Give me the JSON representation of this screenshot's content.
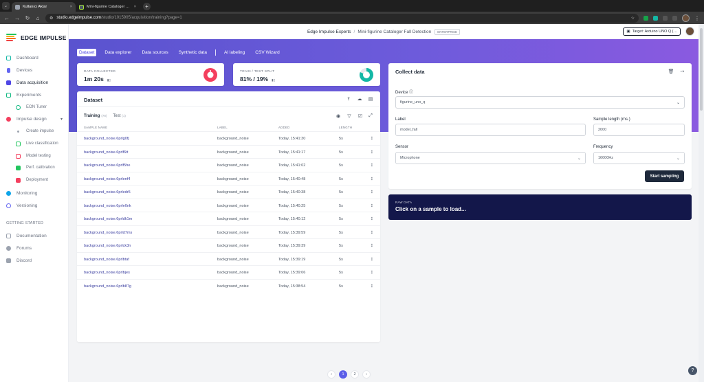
{
  "browser": {
    "tabs": [
      {
        "title": "Kullanıcı Aktar",
        "active": true
      },
      {
        "title": "Mini-figurine Cataloger Fall De",
        "active": false
      }
    ],
    "url_host": "studio.edgeimpulse.com",
    "url_path": "/studio/1015905/acquisition/training?page=1"
  },
  "app": {
    "brand": "EDGE IMPULSE",
    "breadcrumb_owner": "Edge Impulse Experts",
    "breadcrumb_sep": "/",
    "project_name": "Mini-figurine Cataloger Fall Detection",
    "project_badge": "ENTERPRISE",
    "target_label": "Target: Arduino UNO Q (…",
    "accent": "#5b5ee8"
  },
  "sidebar": {
    "items": [
      {
        "label": "Dashboard",
        "icon": "monitor-icon"
      },
      {
        "label": "Devices",
        "icon": "device-icon"
      },
      {
        "label": "Data acquisition",
        "icon": "database-icon",
        "active": true
      },
      {
        "label": "Experiments",
        "icon": "experiments-icon"
      },
      {
        "label": "EON Tuner",
        "icon": "tuner-icon"
      },
      {
        "label": "Impulse design",
        "icon": "impulse-icon"
      },
      {
        "label": "Create impulse",
        "icon": "dot-icon"
      },
      {
        "label": "Live classification",
        "icon": "live-icon"
      },
      {
        "label": "Model testing",
        "icon": "testing-icon"
      },
      {
        "label": "Perf. calibration",
        "icon": "calibration-icon"
      },
      {
        "label": "Deployment",
        "icon": "deploy-icon"
      },
      {
        "label": "Monitoring",
        "icon": "monitoring-icon"
      },
      {
        "label": "Versioning",
        "icon": "versioning-icon"
      }
    ],
    "getting_started_heading": "GETTING STARTED",
    "getting_started": [
      {
        "label": "Documentation",
        "icon": "book-icon"
      },
      {
        "label": "Forums",
        "icon": "forum-icon"
      },
      {
        "label": "Discord",
        "icon": "discord-icon"
      }
    ]
  },
  "top_tabs": [
    "Dataset",
    "Data explorer",
    "Data sources",
    "Synthetic data",
    "AI labeling",
    "CSV Wizard"
  ],
  "stats": {
    "collected_label": "DATA COLLECTED",
    "collected_value": "1m 20s",
    "split_label": "TRAIN / TEST SPLIT",
    "split_value": "81% / 19%",
    "train_fraction": 0.81
  },
  "dataset": {
    "title": "Dataset",
    "tab_training": "Training",
    "tab_training_count": "(78)",
    "tab_test": "Test",
    "tab_test_count": "(1)",
    "columns": [
      "SAMPLE NAME",
      "LABEL",
      "ADDED",
      "LENGTH"
    ],
    "rows": [
      {
        "name": "background_noise.6prlg0fj",
        "label": "background_noise",
        "added": "Today, 15:41:30",
        "length": "5s"
      },
      {
        "name": "background_noise.6prlf6tt",
        "label": "background_noise",
        "added": "Today, 15:41:17",
        "length": "5s"
      },
      {
        "name": "background_noise.6prlf5he",
        "label": "background_noise",
        "added": "Today, 15:41:02",
        "length": "5s"
      },
      {
        "name": "background_noise.6prlenf4",
        "label": "background_noise",
        "added": "Today, 15:40:48",
        "length": "5s"
      },
      {
        "name": "background_noise.6prledr5",
        "label": "background_noise",
        "added": "Today, 15:40:38",
        "length": "5s"
      },
      {
        "name": "background_noise.6prle0nk",
        "label": "background_noise",
        "added": "Today, 15:40:25",
        "length": "5s"
      },
      {
        "name": "background_noise.6prldk1m",
        "label": "background_noise",
        "added": "Today, 15:40:12",
        "length": "5s"
      },
      {
        "name": "background_noise.6prld7ms",
        "label": "background_noise",
        "added": "Today, 15:39:59",
        "length": "5s"
      },
      {
        "name": "background_noise.6prlck3n",
        "label": "background_noise",
        "added": "Today, 15:39:39",
        "length": "5s"
      },
      {
        "name": "background_noise.6prlbtaf",
        "label": "background_noise",
        "added": "Today, 15:39:19",
        "length": "5s"
      },
      {
        "name": "background_noise.6prlbjes",
        "label": "background_noise",
        "added": "Today, 15:39:06",
        "length": "5s"
      },
      {
        "name": "background_noise.6prlb87g",
        "label": "background_noise",
        "added": "Today, 15:38:54",
        "length": "5s"
      }
    ],
    "more_icon": "⋮",
    "pages": [
      "1",
      "2"
    ],
    "current_page": "1"
  },
  "collect": {
    "title": "Collect data",
    "device_label": "Device",
    "device_value": "figurine_uno_q",
    "label_label": "Label",
    "label_value": "model_fall",
    "sample_length_label": "Sample length (ms.)",
    "sample_length_value": "2000",
    "sensor_label": "Sensor",
    "sensor_value": "Microphone",
    "frequency_label": "Frequency",
    "frequency_value": "16000Hz",
    "start_button": "Start sampling"
  },
  "raw": {
    "label": "RAW DATA",
    "message": "Click on a sample to load..."
  }
}
